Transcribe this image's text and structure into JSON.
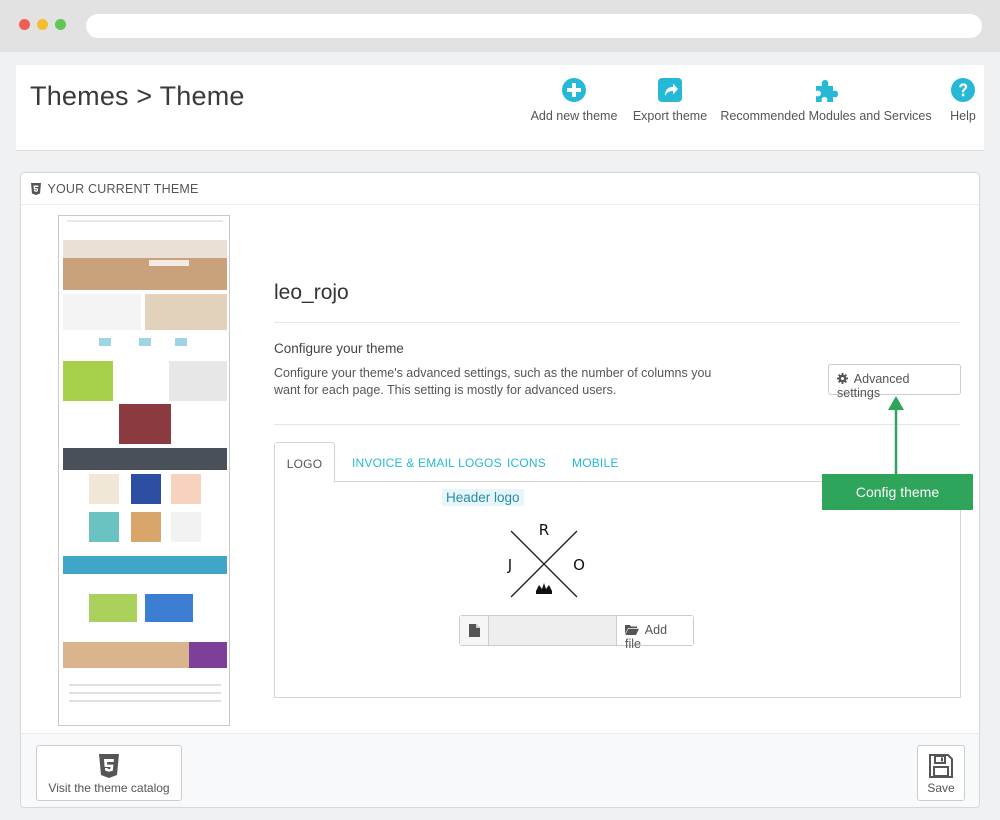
{
  "header": {
    "title": "Themes > Theme",
    "toolbar": [
      {
        "label": "Add new theme",
        "icon": "plus-circle-icon"
      },
      {
        "label": "Export theme",
        "icon": "share-icon"
      },
      {
        "label": "Recommended Modules and Services",
        "icon": "puzzle-icon"
      },
      {
        "label": "Help",
        "icon": "question-circle-icon"
      }
    ]
  },
  "panel": {
    "heading": "YOUR CURRENT THEME",
    "theme_name": "leo_rojo",
    "configure": {
      "title": "Configure your theme",
      "description": "Configure your theme's advanced settings, such as the number of columns you want for each page. This setting is mostly for advanced users.",
      "button_label": "Advanced settings"
    },
    "tabs": [
      {
        "label": "LOGO",
        "active": true
      },
      {
        "label": "INVOICE & EMAIL LOGOS",
        "active": false
      },
      {
        "label": "ICONS",
        "active": false
      },
      {
        "label": "MOBILE",
        "active": false
      }
    ],
    "logo": {
      "label": "Header logo",
      "letters": {
        "top": "R",
        "left": "J",
        "right": "O"
      },
      "add_file_label": "Add file"
    },
    "footer": {
      "catalog_label": "Visit the theme catalog",
      "save_label": "Save"
    }
  },
  "annotation": {
    "label": "Config theme",
    "color": "#2ea55a"
  },
  "colors": {
    "accent": "#25b9d7",
    "text": "#555555"
  }
}
